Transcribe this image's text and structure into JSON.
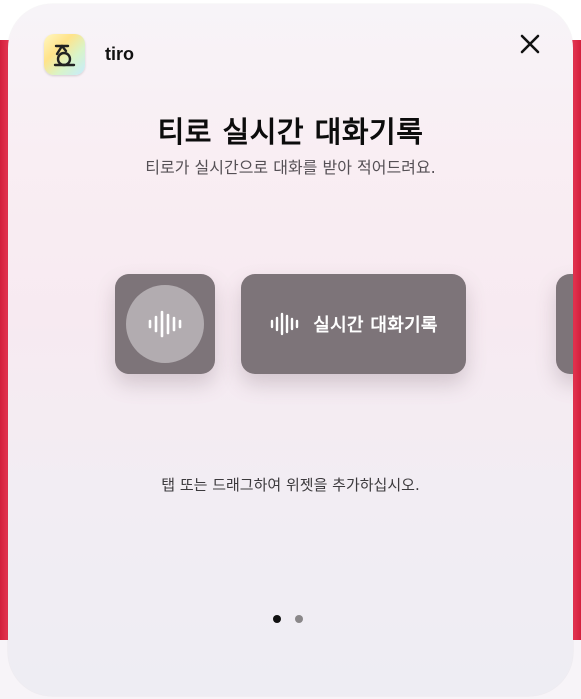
{
  "app": {
    "name": "tiro",
    "icon": "tiro-app-icon"
  },
  "close_icon": "close-icon",
  "header": {
    "title": "티로 실시간 대화기록",
    "subtitle": "티로가 실시간으로 대화를 받아 적어드려요."
  },
  "widgets": {
    "small": {
      "icon": "waveform-icon"
    },
    "medium": {
      "icon": "waveform-icon",
      "label": "실시간 대화기록"
    }
  },
  "hint": "탭 또는 드래그하여 위젯을 추가하십시오.",
  "pagination": {
    "current": 1,
    "total": 2
  },
  "colors": {
    "widget_bg": "#7d7479",
    "widget_circle": "#b2acb0",
    "backdrop_accent": "#d21f3c",
    "dot_active": "#111111",
    "dot_inactive": "#8a8789"
  }
}
